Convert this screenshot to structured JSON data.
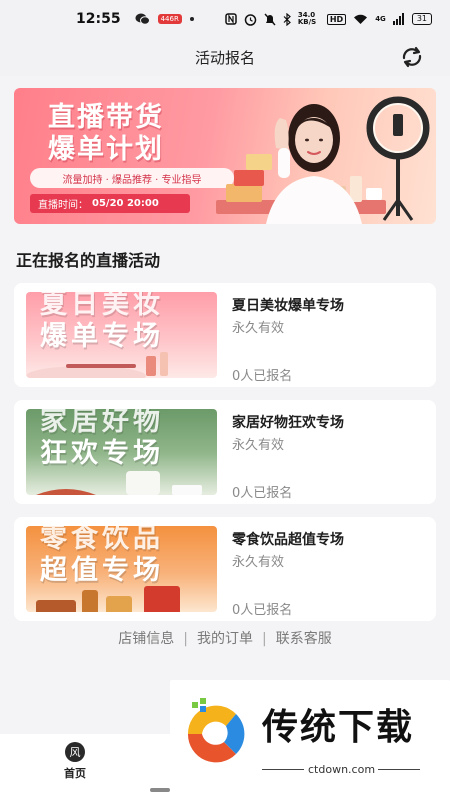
{
  "status_bar": {
    "time": "12:55",
    "app_badge": "446R",
    "speed": "34.0 KB/S",
    "hd": "HD",
    "signal": "4G",
    "battery": "31"
  },
  "header": {
    "title": "活动报名"
  },
  "banner": {
    "title_line1": "直播带货",
    "title_line2": "爆单计划",
    "tags": "流量加持 · 爆品推荐 · 专业指导",
    "time_label": "直播时间：",
    "time_value": "05/20 20:00"
  },
  "section": {
    "title": "正在报名的直播活动"
  },
  "activities": [
    {
      "thumb_top": "夏日美妆",
      "thumb_bottom": "爆单专场",
      "title": "夏日美妆爆单专场",
      "validity": "永久有效",
      "count": "0人已报名",
      "color_from": "#ffb3ba",
      "color_to": "#fde0e0"
    },
    {
      "thumb_top": "家居好物",
      "thumb_bottom": "狂欢专场",
      "title": "家居好物狂欢专场",
      "validity": "永久有效",
      "count": "0人已报名",
      "color_from": "#6f9b6c",
      "color_to": "#e8efe4"
    },
    {
      "thumb_top": "零食饮品",
      "thumb_bottom": "超值专场",
      "title": "零食饮品超值专场",
      "validity": "永久有效",
      "count": "0人已报名",
      "color_from": "#f7a05a",
      "color_to": "#fde2c7"
    }
  ],
  "footer_links": {
    "shop_info": "店铺信息",
    "my_orders": "我的订单",
    "contact": "联系客服",
    "separator": "|"
  },
  "tabbar": {
    "home_icon_text": "风",
    "home_label": "首页"
  },
  "watermark": {
    "brand": "传统下载",
    "url": "ctdown.com"
  }
}
